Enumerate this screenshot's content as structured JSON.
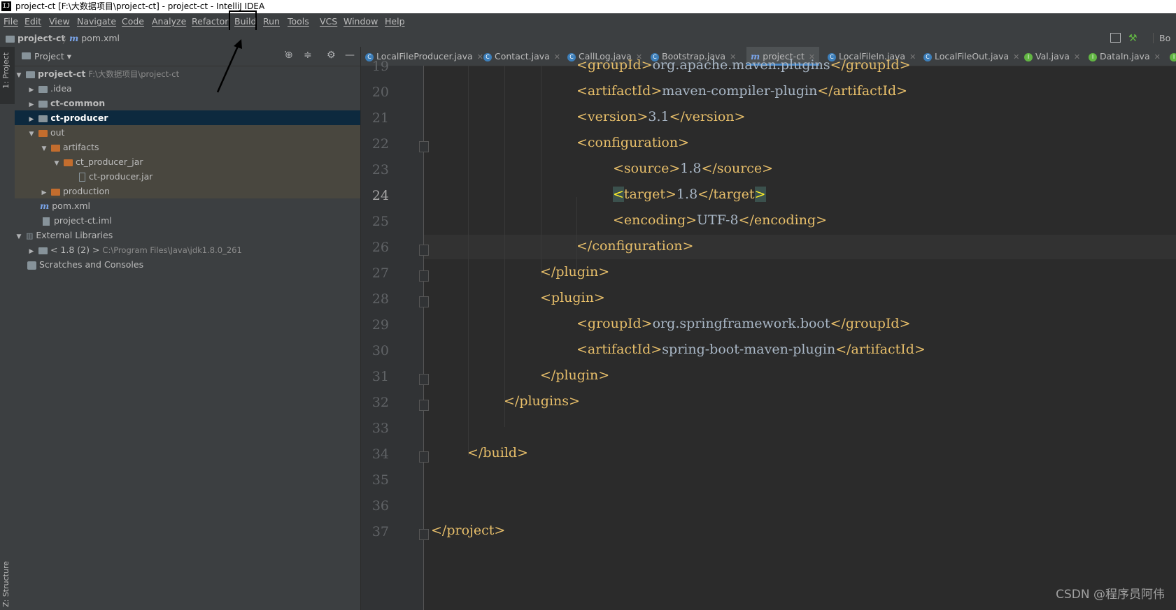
{
  "window": {
    "title": "project-ct [F:\\大数据项目\\project-ct] - project-ct - IntelliJ IDEA",
    "app_icon": "IJ"
  },
  "menu": {
    "file": "File",
    "edit": "Edit",
    "view": "View",
    "navigate": "Navigate",
    "code": "Code",
    "analyze": "Analyze",
    "refactor": "Refactor",
    "build": "Build",
    "run": "Run",
    "tools": "Tools",
    "vcs": "VCS",
    "window": "Window",
    "help": "Help"
  },
  "navbar": {
    "project": "project-ct",
    "file": "pom.xml",
    "right_label": "Bo"
  },
  "sidebar": {
    "project_stripe": "1: Project",
    "structure_stripe": "Z: Structure"
  },
  "project_panel": {
    "header": "Project",
    "tree": {
      "root": "project-ct",
      "root_path": "F:\\大数据项目\\project-ct",
      "idea": ".idea",
      "ct_common": "ct-common",
      "ct_producer": "ct-producer",
      "out": "out",
      "artifacts": "artifacts",
      "ct_producer_jar_dir": "ct_producer_jar",
      "ct_producer_jar": "ct-producer.jar",
      "production": "production",
      "pom": "pom.xml",
      "iml": "project-ct.iml",
      "external_libraries": "External Libraries",
      "jdk": "< 1.8 (2) >",
      "jdk_path": "C:\\Program Files\\Java\\jdk1.8.0_261",
      "scratches": "Scratches and Consoles"
    }
  },
  "tabs": [
    {
      "label": "LocalFileProducer.java",
      "icon": "c"
    },
    {
      "label": "Contact.java",
      "icon": "c"
    },
    {
      "label": "CallLog.java",
      "icon": "c"
    },
    {
      "label": "Bootstrap.java",
      "icon": "c"
    },
    {
      "label": "project-ct",
      "icon": "m"
    },
    {
      "label": "LocalFileIn.java",
      "icon": "c"
    },
    {
      "label": "LocalFileOut.java",
      "icon": "c"
    },
    {
      "label": "Val.java",
      "icon": "i"
    },
    {
      "label": "DataIn.java",
      "icon": "i"
    }
  ],
  "editor": {
    "current_line": 24,
    "lines": [
      {
        "no": "19",
        "open": "<groupId>",
        "text": "org.apache.maven.plugins",
        "close": "</groupId>"
      },
      {
        "no": "20",
        "open": "<artifactId>",
        "text": "maven-compiler-plugin",
        "close": "</artifactId>"
      },
      {
        "no": "21",
        "open": "<version>",
        "text": "3.1",
        "close": "</version>"
      },
      {
        "no": "22",
        "open": "<configuration>",
        "text": "",
        "close": ""
      },
      {
        "no": "23",
        "open": "<source>",
        "text": "1.8",
        "close": "</source>"
      },
      {
        "no": "24",
        "open": "<",
        "open2": "target>",
        "text": "1.8",
        "close": "</target",
        "close2": ">"
      },
      {
        "no": "25",
        "open": "<encoding>",
        "text": "UTF-8",
        "close": "</encoding>"
      },
      {
        "no": "26",
        "open": "</configuration>",
        "text": "",
        "close": ""
      },
      {
        "no": "27",
        "open": "</plugin>",
        "text": "",
        "close": ""
      },
      {
        "no": "28",
        "open": "<plugin>",
        "text": "",
        "close": ""
      },
      {
        "no": "29",
        "open": "<groupId>",
        "text": "org.springframework.boot",
        "close": "</groupId>"
      },
      {
        "no": "30",
        "open": "<artifactId>",
        "text": "spring-boot-maven-plugin",
        "close": "</artifactId>"
      },
      {
        "no": "31",
        "open": "</plugin>",
        "text": "",
        "close": ""
      },
      {
        "no": "32",
        "open": "</plugins>",
        "text": "",
        "close": ""
      },
      {
        "no": "33",
        "open": "",
        "text": "",
        "close": ""
      },
      {
        "no": "34",
        "open": "</build>",
        "text": "",
        "close": ""
      },
      {
        "no": "35",
        "open": "",
        "text": "",
        "close": ""
      },
      {
        "no": "36",
        "open": "",
        "text": "",
        "close": ""
      },
      {
        "no": "37",
        "open": "</project>",
        "text": "",
        "close": ""
      }
    ]
  },
  "watermark": "CSDN @程序员阿伟",
  "colors": {
    "tag": "#e8bf6a",
    "text": "#a9b7c6",
    "background": "#2b2b2b",
    "panel": "#3c3f41",
    "selection": "#0d293e",
    "accent": "#4a88c7"
  }
}
